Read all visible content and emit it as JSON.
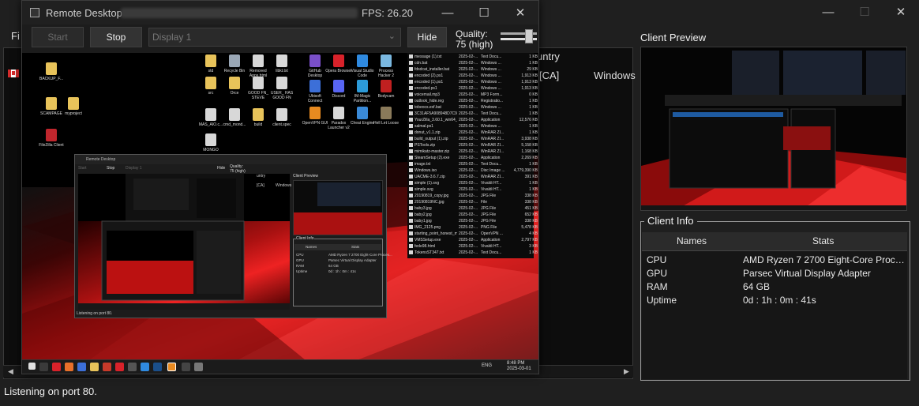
{
  "main_window": {
    "menu_fragment": "Fi",
    "list_fragments": [
      "untry",
      "[CA]",
      "Windows"
    ],
    "status_text": "Listening on port 80.",
    "client_preview_label": "Client Preview",
    "client_info": {
      "legend": "Client Info",
      "columns": [
        "Names",
        "Stats"
      ],
      "rows": [
        {
          "name": "CPU",
          "stat": "AMD Ryzen 7 2700 Eight-Core Processor"
        },
        {
          "name": "GPU",
          "stat": "Parsec Virtual Display Adapter"
        },
        {
          "name": "RAM",
          "stat": "64 GB"
        },
        {
          "name": "Uptime",
          "stat": "0d : 1h : 0m : 41s"
        }
      ]
    }
  },
  "remote_window": {
    "title": "Remote Desktop -",
    "fps_text": "FPS: 26.20",
    "start_label": "Start",
    "stop_label": "Stop",
    "display_value": "Display 1",
    "hide_label": "Hide",
    "quality_label": "Quality:",
    "quality_value": "75 (high)",
    "quality_level": 0.75
  },
  "remote_desktop": {
    "desktop_icons": [
      {
        "label": "BACKUP_F...",
        "color": "#e8c35a"
      },
      {
        "label": "SCAMPAGE",
        "color": "#e8c35a"
      },
      {
        "label": "myproject",
        "color": "#e8c35a"
      },
      {
        "label": "FileZilla Client",
        "color": "#c0262d"
      },
      {
        "label": "std",
        "color": "#e8c35a"
      },
      {
        "label": "Recycle Bin",
        "color": "#9aa7b5"
      },
      {
        "label": "Removed Apps.html",
        "color": "#d8d8d8"
      },
      {
        "label": "libkt.txt",
        "color": "#d8d8d8"
      },
      {
        "label": "GitHub Desktop",
        "color": "#7a4fc9"
      },
      {
        "label": "Opera Browser",
        "color": "#d8222a"
      },
      {
        "label": "Visual Studio Code",
        "color": "#2f8ae0"
      },
      {
        "label": "Process Hacker 2",
        "color": "#7ab8e0"
      },
      {
        "label": "src",
        "color": "#e8c35a"
      },
      {
        "label": "Orce",
        "color": "#e8c35a"
      },
      {
        "label": "GOOD FN_ STEVE",
        "color": "#d8d8d8"
      },
      {
        "label": "USER_ HAS GOOD FN",
        "color": "#d8d8d8"
      },
      {
        "label": "Ubisoft Connect",
        "color": "#3c6fd8"
      },
      {
        "label": "Discord",
        "color": "#5865f2"
      },
      {
        "label": "IM-Magic Partition...",
        "color": "#2c9ad8"
      },
      {
        "label": "Bodycam",
        "color": "#c02020"
      },
      {
        "label": "MAS_AIO.c...",
        "color": "#d8d8d8"
      },
      {
        "label": "cmd_mond...",
        "color": "#d8d8d8"
      },
      {
        "label": "build",
        "color": "#e8c35a"
      },
      {
        "label": "client.spec",
        "color": "#d8d8d8"
      },
      {
        "label": "OpenVPN GUI",
        "color": "#e88a20"
      },
      {
        "label": "Paradox Launcher v2",
        "color": "#d8d8d8"
      },
      {
        "label": "Cheat Engine",
        "color": "#3a8ad8"
      },
      {
        "label": "Hell Let Loose",
        "color": "#8a7a5a"
      },
      {
        "label": "MONGO",
        "color": "#d8d8d8"
      }
    ],
    "files": [
      {
        "name": "message (1).txt",
        "date": "2025-02-...",
        "type": "Text Docu...",
        "size": "1 KB"
      },
      {
        "name": "cdn.bat",
        "date": "2025-02-...",
        "type": "Windows ...",
        "size": "1 KB"
      },
      {
        "name": "fdsdcat_installer.bat",
        "date": "2025-02-...",
        "type": "Windows ...",
        "size": "29 KB"
      },
      {
        "name": "encoded (2).ps1",
        "date": "2025-02-...",
        "type": "Windows ...",
        "size": "1,913 KB"
      },
      {
        "name": "encoded (1).ps1",
        "date": "2025-02-...",
        "type": "Windows ...",
        "size": "1,913 KB"
      },
      {
        "name": "encoded.ps1",
        "date": "2025-02-...",
        "type": "Windows ...",
        "size": "1,913 KB"
      },
      {
        "name": "voicemail.mp3",
        "date": "2025-02-...",
        "type": "MP3 Form...",
        "size": "0 KB"
      },
      {
        "name": "outlook_hide.reg",
        "date": "2025-02-...",
        "type": "Registratio...",
        "size": "1 KB"
      },
      {
        "name": "tobeocs.exf.bat",
        "date": "2025-02-...",
        "type": "Windows ...",
        "size": "1 KB"
      },
      {
        "name": "3C31AF5A908948D7C9...",
        "date": "2025-02-...",
        "type": "Text Docu...",
        "size": "1 KB"
      },
      {
        "name": "YourZilla_3.60.1_win64_s...",
        "date": "2025-02-...",
        "type": "Application",
        "size": "12,576 KB"
      },
      {
        "name": "salmal.ps1",
        "date": "2025-02-...",
        "type": "Windows ...",
        "size": "1 KB"
      },
      {
        "name": "donut_v1.1.zip",
        "date": "2025-02-...",
        "type": "WinRAR ZI...",
        "size": "1 KB"
      },
      {
        "name": "build_output (1).zip",
        "date": "2025-02-...",
        "type": "WinRAR ZI...",
        "size": "3,938 KB"
      },
      {
        "name": "PSTools.zip",
        "date": "2025-02-...",
        "type": "WinRAR ZI...",
        "size": "5,158 KB"
      },
      {
        "name": "mimikatz-master.zip",
        "date": "2025-02-...",
        "type": "WinRAR ZI...",
        "size": "1,168 KB"
      },
      {
        "name": "SteamSetup (2).exe",
        "date": "2025-02-...",
        "type": "Application",
        "size": "2,269 KB"
      },
      {
        "name": "image.txt",
        "date": "2025-02-...",
        "type": "Text Docu...",
        "size": "1 KB"
      },
      {
        "name": "Windows.iso",
        "date": "2025-02-...",
        "type": "Disc Image ...",
        "size": "4,779,390 KB"
      },
      {
        "name": "UACME-3.6.7.zip",
        "date": "2025-02-...",
        "type": "WinRAR ZI...",
        "size": "391 KB"
      },
      {
        "name": "simple (1).svg",
        "date": "2025-02-...",
        "type": "Vivaldi HT...",
        "size": "1 KB"
      },
      {
        "name": "simple.svg",
        "date": "2025-02-...",
        "type": "Vivaldi HT...",
        "size": "1 KB"
      },
      {
        "name": "20190819_copy.jpg",
        "date": "2025-02-...",
        "type": "JPG File",
        "size": "338 KB"
      },
      {
        "name": "20190819NC.jpg",
        "date": "2025-02-...",
        "type": "File",
        "size": "338 KB"
      },
      {
        "name": "baby3.jpg",
        "date": "2025-02-...",
        "type": "JPG File",
        "size": "451 KB"
      },
      {
        "name": "baby2.jpg",
        "date": "2025-02-...",
        "type": "JPG File",
        "size": "652 KB"
      },
      {
        "name": "baby1.jpg",
        "date": "2025-02-...",
        "type": "JPG File",
        "size": "338 KB"
      },
      {
        "name": "IMG_2125.png",
        "date": "2025-02-...",
        "type": "PNG File",
        "size": "5,478 KB"
      },
      {
        "name": "starting_point_honest_m...",
        "date": "2025-02-...",
        "type": "OpenVPN ...",
        "size": "4 KB"
      },
      {
        "name": "VMSSetup.exe",
        "date": "2025-02-...",
        "type": "Application",
        "size": "2,797 KB"
      },
      {
        "name": "fede98.html",
        "date": "2025-02-...",
        "type": "Vivaldi HT...",
        "size": "3 KB"
      },
      {
        "name": "TokensST347.txt",
        "date": "2025-02-...",
        "type": "Text Docu...",
        "size": "1 KB"
      }
    ],
    "taskbar": {
      "lang": "ENG",
      "time": "8:48 PM",
      "date": "2025-03-01"
    },
    "nested": {
      "title": "Remote Desktop",
      "start": "Start",
      "stop": "Stop",
      "display": "Display 1",
      "hide": "Hide",
      "quality": "Quality:",
      "quality_value": "75 (high)",
      "col_fragment": "untry",
      "row_fragment": "[CA]",
      "row_os": "Windows",
      "client_preview": "Client Preview",
      "client_info": "Client Info",
      "names": "Names",
      "stats": "Stats",
      "rows": [
        {
          "name": "CPU",
          "stat": "AMD Ryzen 7 2700 Eight-Core Proces..."
        },
        {
          "name": "GPU",
          "stat": "Parsec Virtual Display Adapter"
        },
        {
          "name": "RAM",
          "stat": "64 GB"
        },
        {
          "name": "Uptime",
          "stat": "0d : 1h : 0m : 41s"
        }
      ],
      "status": "Listening on port 80."
    }
  },
  "colors": {
    "background": "#1f1f1f",
    "panel": "#0d0d0d",
    "button": "#333333",
    "accent_red": "#e12222",
    "text": "#e8e8e8"
  },
  "icons": {
    "minimize": "minimize-icon",
    "maximize": "maximize-icon",
    "close": "close-icon",
    "app": "app-icon"
  }
}
